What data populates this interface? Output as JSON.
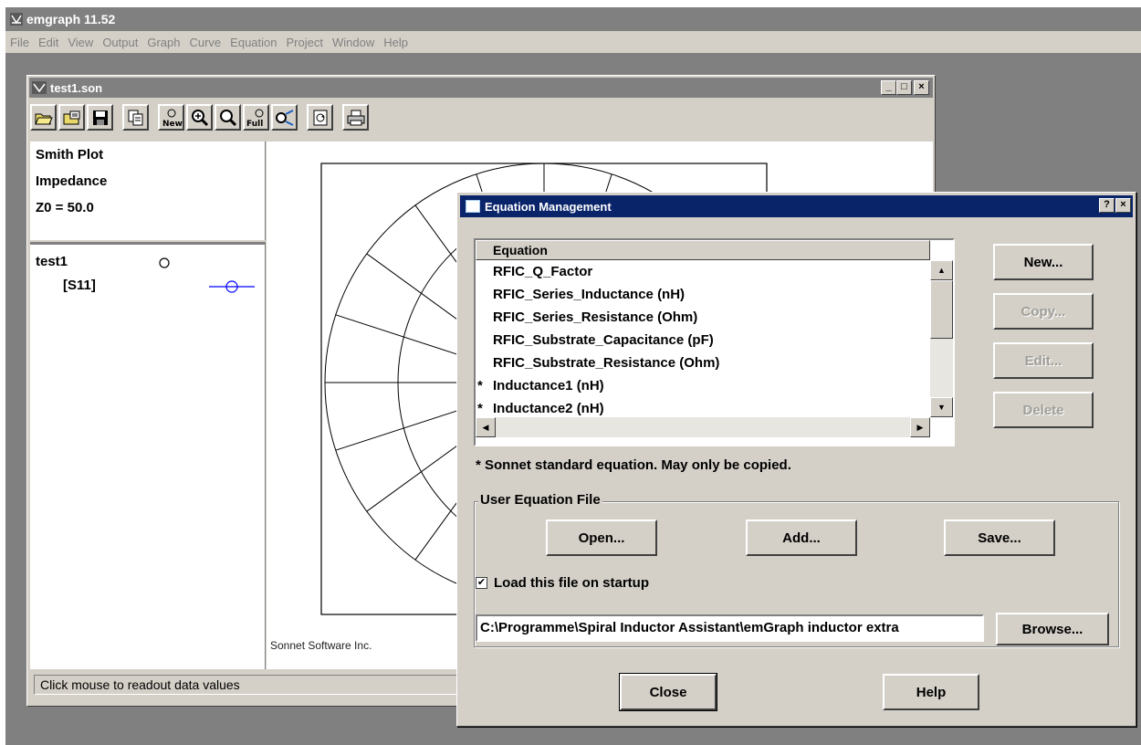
{
  "app": {
    "title": "emgraph 11.52",
    "menu": [
      "File",
      "Edit",
      "View",
      "Output",
      "Graph",
      "Curve",
      "Equation",
      "Project",
      "Window",
      "Help"
    ]
  },
  "child_window": {
    "title": "test1.son",
    "toolbar": [
      {
        "icon": "open-folder-icon"
      },
      {
        "icon": "open-project-icon"
      },
      {
        "icon": "save-icon"
      },
      {
        "icon": "copy-icon"
      },
      {
        "icon": "new-graph-icon",
        "text": "New"
      },
      {
        "icon": "zoom-in-icon"
      },
      {
        "icon": "zoom-out-icon"
      },
      {
        "icon": "zoom-full-icon",
        "text": "Full"
      },
      {
        "icon": "add-curve-icon"
      },
      {
        "icon": "refresh-icon"
      },
      {
        "icon": "print-icon"
      }
    ],
    "legend": {
      "plot_type": "Smith Plot",
      "param": "Impedance",
      "z0": "Z0 = 50.0"
    },
    "curve_group": "test1",
    "curve_name": "[S11]",
    "plot_credit": "Sonnet Software Inc.",
    "status_text": "Click mouse to readout data values",
    "colors": {
      "curve": "#0000ff",
      "grid": "#000000"
    }
  },
  "dialog": {
    "title": "Equation Management",
    "list_header": "Equation",
    "equations": [
      {
        "name": "RFIC_Q_Factor",
        "standard": false
      },
      {
        "name": "RFIC_Series_Inductance (nH)",
        "standard": false
      },
      {
        "name": "RFIC_Series_Resistance (Ohm)",
        "standard": false
      },
      {
        "name": "RFIC_Substrate_Capacitance (pF)",
        "standard": false
      },
      {
        "name": "RFIC_Substrate_Resistance (Ohm)",
        "standard": false
      },
      {
        "name": "Inductance1 (nH)",
        "standard": true
      },
      {
        "name": "Inductance2 (nH)",
        "standard": true
      }
    ],
    "star": "*",
    "note": "* Sonnet standard equation.  May only be copied.",
    "buttons": {
      "new": "New...",
      "copy": "Copy...",
      "edit": "Edit...",
      "delete": "Delete",
      "open": "Open...",
      "add": "Add...",
      "save": "Save...",
      "browse": "Browse...",
      "close": "Close",
      "help": "Help"
    },
    "group_label": "User Equation File",
    "load_on_startup_label": "Load this file on startup",
    "load_on_startup_checked": true,
    "file_path": "C:\\Programme\\Spiral Inductor Assistant\\emGraph inductor extra"
  }
}
